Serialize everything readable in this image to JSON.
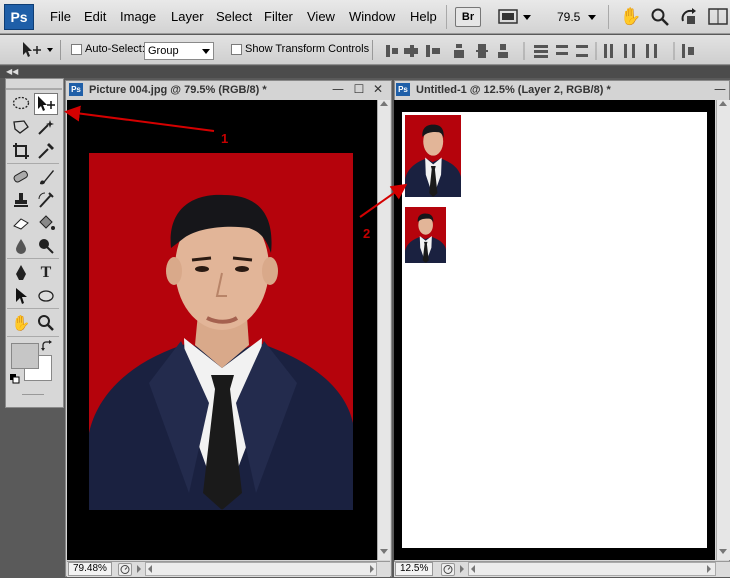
{
  "app": {
    "logo": "Ps",
    "bridge": "Br"
  },
  "menu": [
    "File",
    "Edit",
    "Image",
    "Layer",
    "Select",
    "Filter",
    "View",
    "Window",
    "Help"
  ],
  "menubar": {
    "zoom_value": "79.5"
  },
  "options": {
    "auto_select_label": "Auto-Select:",
    "auto_select_value": "Group",
    "transform_label": "Show Transform Controls"
  },
  "doc1": {
    "title": "Picture 004.jpg @ 79.5% (RGB/8) *",
    "zoom": "79.48%"
  },
  "doc2": {
    "title": "Untitled-1 @ 12.5% (Layer 2, RGB/8) *",
    "zoom": "12.5%"
  },
  "annotations": {
    "one": "1",
    "two": "2"
  },
  "colors": {
    "background": "#b5030c",
    "suit": "#1a2140",
    "skin": "#e2b598",
    "hair": "#16161a",
    "arrow": "#d40000"
  }
}
